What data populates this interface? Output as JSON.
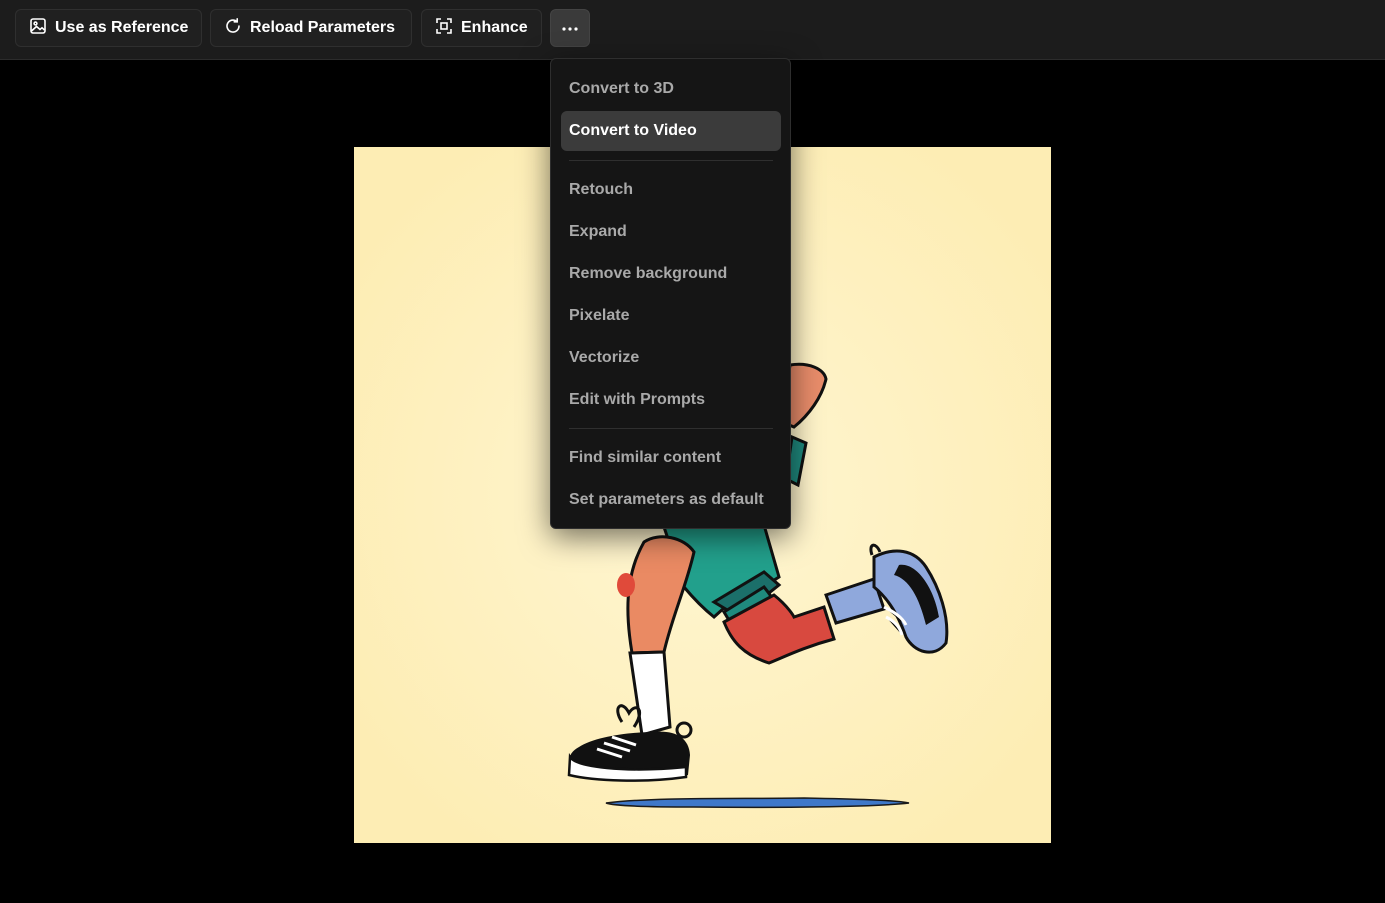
{
  "toolbar": {
    "use_as_reference": "Use as Reference",
    "reload_parameters": "Reload Parameters",
    "enhance": "Enhance"
  },
  "menu": {
    "convert_3d": "Convert to 3D",
    "convert_video": "Convert to Video",
    "retouch": "Retouch",
    "expand": "Expand",
    "remove_background": "Remove background",
    "pixelate": "Pixelate",
    "vectorize": "Vectorize",
    "edit_with_prompts": "Edit with Prompts",
    "find_similar": "Find similar content",
    "set_default": "Set parameters as default",
    "active_item": "Convert to Video"
  },
  "colors": {
    "toolbar_bg": "#1c1c1c",
    "menu_bg": "#151515",
    "menu_active_bg": "#3b3b3b",
    "menu_text": "#a9a9a9",
    "image_bg": "#fdedb4"
  },
  "icons": {
    "use_as_reference": "image-icon",
    "reload_parameters": "reload-icon",
    "enhance": "enhance-frame-icon",
    "more": "ellipsis-icon"
  }
}
